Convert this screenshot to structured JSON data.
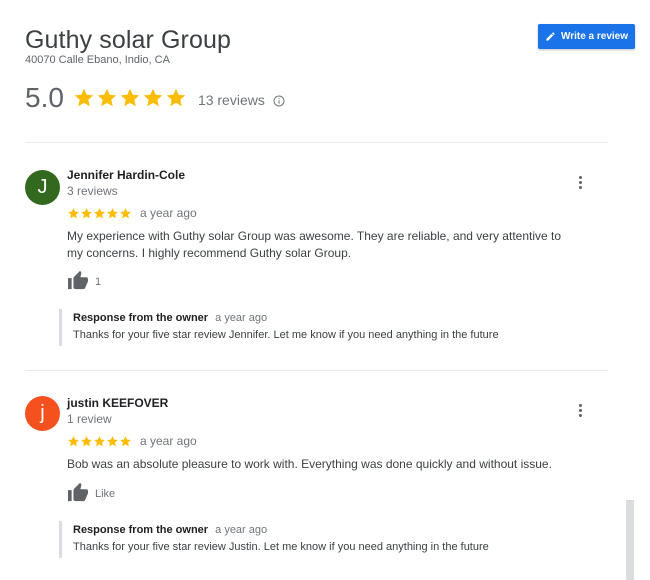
{
  "business": {
    "name": "Guthy solar Group",
    "address": "40070 Calle Ebano, Indio, CA"
  },
  "write_review": {
    "label": "Write a review",
    "icon": "pencil-icon"
  },
  "summary": {
    "rating": "5.0",
    "stars": 5,
    "reviews_label": "13 reviews",
    "info_icon": "info-icon"
  },
  "colors": {
    "star": "#fbbc04",
    "accent": "#1a73e8"
  },
  "reviews": [
    {
      "avatar_letter": "J",
      "avatar_color": "#33691e",
      "name": "Jennifer Hardin-Cole",
      "meta": "3 reviews",
      "stars": 5,
      "date": "a year ago",
      "text": "My experience with Guthy solar Group was awesome. They are reliable,  and very attentive to my concerns.  I highly recommend Guthy solar Group.",
      "like_label": "1",
      "response": {
        "title": "Response from the owner",
        "date": "a year ago",
        "text": "Thanks for your five star review Jennifer. Let me know if you need anything in the future"
      }
    },
    {
      "avatar_letter": "j",
      "avatar_color": "#f4511e",
      "name": "justin KEEFOVER",
      "meta": "1 review",
      "stars": 5,
      "date": "a year ago",
      "text": "Bob was an absolute pleasure to work with. Everything was done quickly and without issue.",
      "like_label": "Like",
      "response": {
        "title": "Response from the owner",
        "date": "a year ago",
        "text": "Thanks for your five star review Justin. Let me know if you need anything in the future"
      }
    }
  ]
}
